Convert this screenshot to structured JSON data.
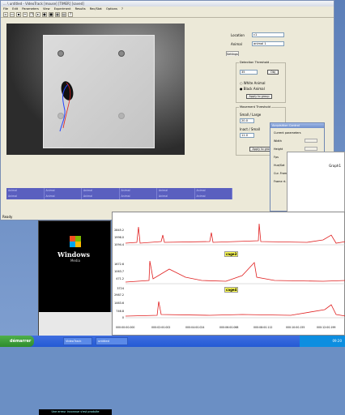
{
  "main_window": {
    "title": "... \\ untitled - VideoTrack [mouse] [TIMER] [saved]",
    "menu": [
      "File",
      "Edit",
      "Parameters",
      "View",
      "Experiment",
      "Results",
      "Rec/Stat",
      "Options",
      "?"
    ],
    "status": "Ready"
  },
  "panel": {
    "location_label": "Location",
    "location_value": "c1",
    "animal_label": "Animal",
    "animal_value": "animal 1",
    "settings_tab": "Settings",
    "detection_group": "Detection Threshold",
    "detection_value": "35",
    "detection_unit": "Obj",
    "white_label": "White Animal",
    "black_label": "Black Animal",
    "apply_group": "Apply to group",
    "movement_group": "Movement Threshold",
    "small_large_label": "Small / Large",
    "small_large_value": "20.0",
    "inact_label": "Inact / Small",
    "inact_value": "11.0",
    "apply_group2": "Apply to group",
    "bottom_btn": "Apply"
  },
  "track_rows": [
    [
      "Animal",
      "Animal",
      "Animal",
      "Animal",
      "Animal",
      "Animal"
    ],
    [
      "Animal",
      "Animal",
      "Animal",
      "Animal",
      "Animal",
      "Animal"
    ]
  ],
  "params_window": {
    "title": "Acquisition Control",
    "heading": "Current parameters",
    "rows": [
      "Width",
      "Height",
      "Fps",
      "Hue/Sat",
      "Cur. Frame",
      "Frame rt."
    ]
  },
  "media": {
    "brand": "Windows",
    "product": "Media",
    "status": "Une erreur inconnue s'est produite"
  },
  "graph": {
    "tab": "Graph1",
    "labels": [
      "cage3",
      "cage4"
    ],
    "y_ticks": [
      "2845.2",
      "1996.0",
      "1094.4",
      "1672.6",
      "1063.7",
      "471.2",
      "3724",
      "2987.2",
      "1463.6",
      "746.8",
      "0"
    ],
    "x_ticks": [
      "000:00:00.000",
      "000:02:00.002",
      "000:04:00.024",
      "000:06:00.068",
      "000:08:00.112",
      "000:10:00.155",
      "000:12:00.199"
    ]
  },
  "graph_tab_window": {
    "title": "Graph1"
  },
  "taskbar": {
    "start": "démarrer",
    "tasks": [
      "VideoTrack",
      "untitled"
    ],
    "clock": "09:20"
  },
  "colors": {
    "trace": "#e02020",
    "accent": "#3c6fd8"
  }
}
